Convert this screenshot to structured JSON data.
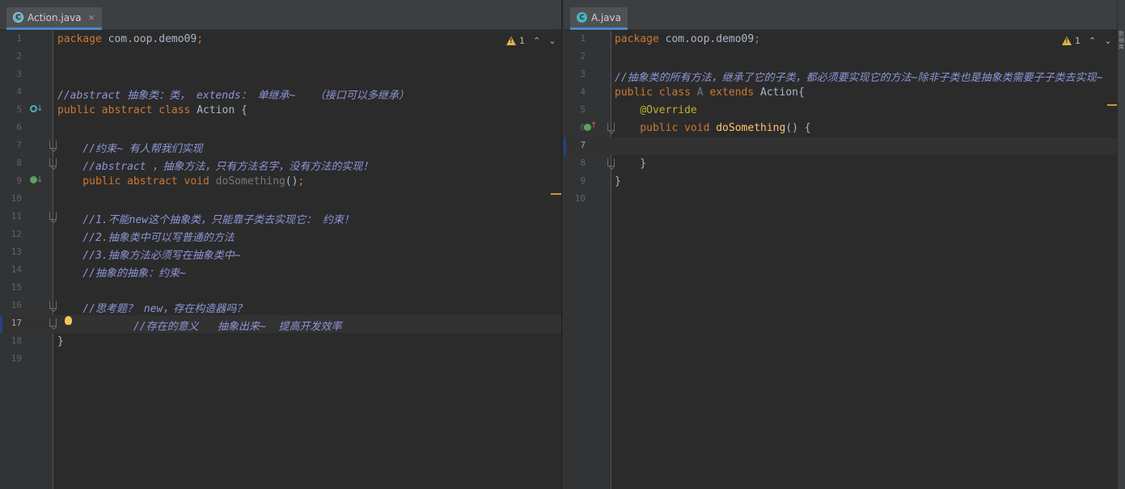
{
  "left_editor": {
    "tab": {
      "label": "Action.java",
      "icon": "abstract-class-icon",
      "close": "×"
    },
    "inspection": {
      "count": "1"
    },
    "lines": [
      {
        "n": "1",
        "tokens": [
          {
            "t": "package ",
            "c": "kw"
          },
          {
            "t": "com.oop.demo09",
            "c": "plain"
          },
          {
            "t": ";",
            "c": "kw"
          }
        ]
      },
      {
        "n": "2",
        "tokens": []
      },
      {
        "n": "3",
        "tokens": []
      },
      {
        "n": "4",
        "tokens": [
          {
            "t": "//abstract 抽象类：类， extends： 单继承~   （接口可以多继承）",
            "c": "cmt"
          }
        ]
      },
      {
        "n": "5",
        "tokens": [
          {
            "t": "public abstract class ",
            "c": "kw"
          },
          {
            "t": "Action {",
            "c": "plain"
          }
        ]
      },
      {
        "n": "6",
        "tokens": []
      },
      {
        "n": "7",
        "tokens": [
          {
            "t": "    //约束~ 有人帮我们实现",
            "c": "cmt"
          }
        ]
      },
      {
        "n": "8",
        "tokens": [
          {
            "t": "    //abstract ，抽象方法，只有方法名字，没有方法的实现！",
            "c": "cmt"
          }
        ]
      },
      {
        "n": "9",
        "tokens": [
          {
            "t": "    public abstract void ",
            "c": "kw"
          },
          {
            "t": "doSomething",
            "c": "dim"
          },
          {
            "t": "()",
            "c": "plain"
          },
          {
            "t": ";",
            "c": "kw"
          }
        ]
      },
      {
        "n": "10",
        "tokens": []
      },
      {
        "n": "11",
        "tokens": [
          {
            "t": "    //1.不能new这个抽象类，只能靠子类去实现它： 约束！",
            "c": "cmt"
          }
        ]
      },
      {
        "n": "12",
        "tokens": [
          {
            "t": "    //2.抽象类中可以写普通的方法",
            "c": "cmt"
          }
        ]
      },
      {
        "n": "13",
        "tokens": [
          {
            "t": "    //3.抽象方法必须写在抽象类中~",
            "c": "cmt"
          }
        ]
      },
      {
        "n": "14",
        "tokens": [
          {
            "t": "    //抽象的抽象：约束~",
            "c": "cmt"
          }
        ]
      },
      {
        "n": "15",
        "tokens": []
      },
      {
        "n": "16",
        "tokens": [
          {
            "t": "    //思考题？ new，存在构造器吗？",
            "c": "cmt"
          }
        ]
      },
      {
        "n": "17",
        "tokens": [
          {
            "t": "            //存在的意义   抽象出来~  提高开发效率",
            "c": "cmt"
          }
        ]
      },
      {
        "n": "18",
        "tokens": [
          {
            "t": "}",
            "c": "plain"
          }
        ]
      },
      {
        "n": "19",
        "tokens": []
      }
    ]
  },
  "right_editor": {
    "tab": {
      "label": "A.java",
      "icon": "class-icon",
      "icon_letter": "C"
    },
    "inspection": {
      "count": "1"
    },
    "lines": [
      {
        "n": "1",
        "tokens": [
          {
            "t": "package ",
            "c": "kw"
          },
          {
            "t": "com.oop.demo09",
            "c": "plain"
          },
          {
            "t": ";",
            "c": "kw"
          }
        ]
      },
      {
        "n": "2",
        "tokens": []
      },
      {
        "n": "3",
        "tokens": [
          {
            "t": "//抽象类的所有方法，继承了它的子类，都必须要实现它的方法~除非子类也是抽象类需要子子类去实现~",
            "c": "cmt"
          }
        ]
      },
      {
        "n": "4",
        "tokens": [
          {
            "t": "public class ",
            "c": "kw"
          },
          {
            "t": "A ",
            "c": "dim"
          },
          {
            "t": "extends ",
            "c": "kw"
          },
          {
            "t": "Action{",
            "c": "plain"
          }
        ]
      },
      {
        "n": "5",
        "tokens": [
          {
            "t": "    @Override",
            "c": "ann"
          }
        ]
      },
      {
        "n": "6",
        "tokens": [
          {
            "t": "    public void ",
            "c": "kw"
          },
          {
            "t": "doSomething",
            "c": "fn"
          },
          {
            "t": "() {",
            "c": "plain"
          }
        ]
      },
      {
        "n": "7",
        "tokens": []
      },
      {
        "n": "8",
        "tokens": [
          {
            "t": "    }",
            "c": "plain"
          }
        ]
      },
      {
        "n": "9",
        "tokens": [
          {
            "t": "}",
            "c": "plain"
          }
        ]
      },
      {
        "n": "10",
        "tokens": []
      }
    ]
  },
  "side_strip": {
    "text": "数据库"
  },
  "colors": {
    "background": "#2b2b2b",
    "keyword": "#cc7832",
    "comment": "#8f95d8",
    "annotation": "#bbb529",
    "method": "#ffc66d",
    "warning": "#e0b54a"
  }
}
